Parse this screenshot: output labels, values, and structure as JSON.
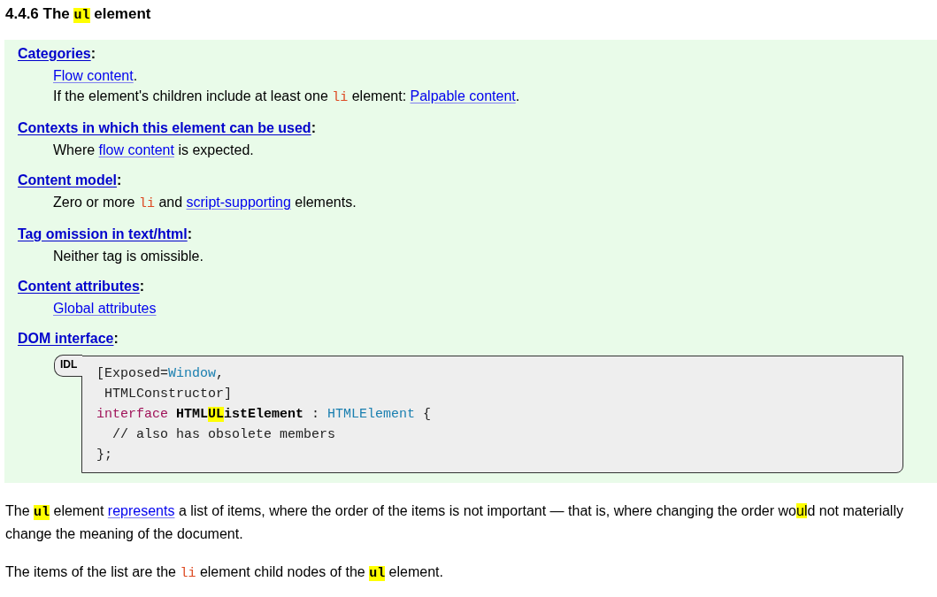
{
  "heading": [
    {
      "kind": "text",
      "text": "4.4.6 The "
    },
    {
      "kind": "code-highlight",
      "text": "ul"
    },
    {
      "kind": "text",
      "text": " element"
    }
  ],
  "definitions": [
    {
      "term": "Categories",
      "suffix": ":",
      "values": [
        [
          {
            "kind": "link",
            "text": "Flow content"
          },
          {
            "kind": "text",
            "text": "."
          }
        ],
        [
          {
            "kind": "text",
            "text": "If the element's children include at least one "
          },
          {
            "kind": "code",
            "text": "li"
          },
          {
            "kind": "text",
            "text": " element: "
          },
          {
            "kind": "link",
            "text": "Palpable content"
          },
          {
            "kind": "text",
            "text": "."
          }
        ]
      ]
    },
    {
      "term": "Contexts in which this element can be used",
      "suffix": ":",
      "values": [
        [
          {
            "kind": "text",
            "text": "Where "
          },
          {
            "kind": "link",
            "text": "flow content"
          },
          {
            "kind": "text",
            "text": " is expected."
          }
        ]
      ]
    },
    {
      "term": "Content model",
      "suffix": ":",
      "values": [
        [
          {
            "kind": "text",
            "text": "Zero or more "
          },
          {
            "kind": "code",
            "text": "li"
          },
          {
            "kind": "text",
            "text": " and "
          },
          {
            "kind": "link",
            "text": "script-supporting"
          },
          {
            "kind": "text",
            "text": " elements."
          }
        ]
      ]
    },
    {
      "term": "Tag omission in text/html",
      "suffix": ":",
      "values": [
        [
          {
            "kind": "text",
            "text": "Neither tag is omissible."
          }
        ]
      ]
    },
    {
      "term": "Content attributes",
      "suffix": ":",
      "values": [
        [
          {
            "kind": "link",
            "text": "Global attributes"
          }
        ]
      ]
    },
    {
      "term": "DOM interface",
      "suffix": ":"
    }
  ],
  "idl": {
    "label": "IDL",
    "lines": [
      [
        {
          "kind": "plain",
          "text": "[Exposed="
        },
        {
          "kind": "type",
          "text": "Window"
        },
        {
          "kind": "plain",
          "text": ","
        }
      ],
      [
        {
          "kind": "plain",
          "text": " HTMLConstructor]"
        }
      ],
      [
        {
          "kind": "keyword",
          "text": "interface"
        },
        {
          "kind": "name",
          "text": " HTML"
        },
        {
          "kind": "name-highlight",
          "text": "UL"
        },
        {
          "kind": "name",
          "text": "istElement"
        },
        {
          "kind": "plain",
          "text": " : "
        },
        {
          "kind": "type",
          "text": "HTMLElement"
        },
        {
          "kind": "plain",
          "text": " {"
        }
      ],
      [
        {
          "kind": "plain",
          "text": "  // also has obsolete members"
        }
      ],
      [
        {
          "kind": "plain",
          "text": "};"
        }
      ]
    ]
  },
  "paragraphs": [
    [
      {
        "kind": "text",
        "text": "The "
      },
      {
        "kind": "code-highlight",
        "text": "ul"
      },
      {
        "kind": "text",
        "text": " element "
      },
      {
        "kind": "link",
        "text": "represents"
      },
      {
        "kind": "text",
        "text": " a list of items, where the order of the items is not important — that is, where changing the order wo"
      },
      {
        "kind": "text-highlight",
        "text": "ul"
      },
      {
        "kind": "text",
        "text": "d not materially change the meaning of the document."
      }
    ],
    [
      {
        "kind": "text",
        "text": "The items of the list are the "
      },
      {
        "kind": "code",
        "text": "li"
      },
      {
        "kind": "text",
        "text": " element child nodes of the "
      },
      {
        "kind": "code-highlight",
        "text": "ul"
      },
      {
        "kind": "text",
        "text": " element."
      }
    ]
  ]
}
